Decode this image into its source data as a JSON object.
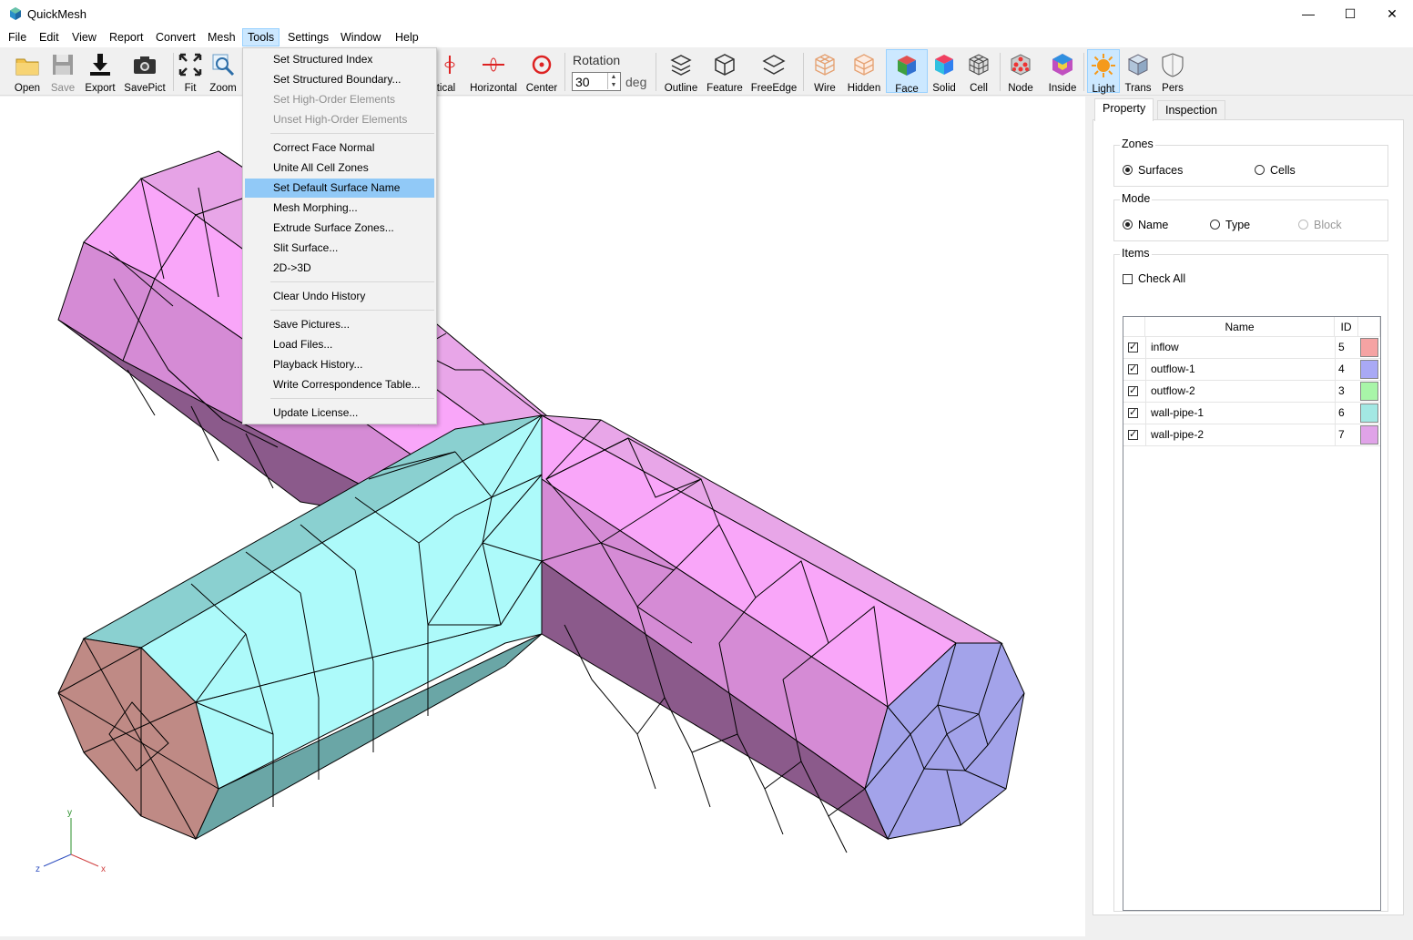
{
  "window": {
    "title": "QuickMesh",
    "min": "—",
    "max": "☐",
    "close": "✕"
  },
  "menubar": [
    "File",
    "Edit",
    "View",
    "Report",
    "Convert",
    "Mesh",
    "Tools",
    "Settings",
    "Window",
    "Help"
  ],
  "toolbar": {
    "open": "Open",
    "save": "Save",
    "export": "Export",
    "savepict": "SavePict",
    "fit": "Fit",
    "zoom": "Zoom",
    "vertical": "rtical",
    "horizontal": "Horizontal",
    "center": "Center",
    "rotation_label": "Rotation",
    "rotation_value": "30",
    "rotation_unit": "deg",
    "outline": "Outline",
    "feature": "Feature",
    "freeedge": "FreeEdge",
    "wire": "Wire",
    "hidden": "Hidden",
    "face": "Face",
    "solid": "Solid",
    "cell": "Cell",
    "node": "Node",
    "inside": "Inside",
    "light": "Light",
    "trans": "Trans",
    "pers": "Pers"
  },
  "tools_menu": {
    "items": [
      "Set Structured Index",
      "Set Structured Boundary...",
      "Set High-Order Elements",
      "Unset High-Order Elements",
      "Correct Face Normal",
      "Unite All Cell Zones",
      "Set Default Surface Name",
      "Mesh Morphing...",
      "Extrude Surface Zones...",
      "Slit Surface...",
      "2D->3D",
      "Clear Undo History",
      "Save Pictures...",
      "Load Files...",
      "Playback History...",
      "Write Correspondence Table...",
      "Update License..."
    ]
  },
  "panel": {
    "tabs": [
      "Property",
      "Inspection"
    ],
    "zones": {
      "title": "Zones",
      "surfaces": "Surfaces",
      "cells": "Cells"
    },
    "mode": {
      "title": "Mode",
      "name": "Name",
      "type": "Type",
      "block": "Block"
    },
    "items": {
      "title": "Items",
      "check_all": "Check All",
      "col_name": "Name",
      "col_id": "ID",
      "rows": [
        {
          "name": "inflow",
          "id": "5",
          "color": "#f5a3a3"
        },
        {
          "name": "outflow-1",
          "id": "4",
          "color": "#a9a9f5"
        },
        {
          "name": "outflow-2",
          "id": "3",
          "color": "#a8f5a8"
        },
        {
          "name": "wall-pipe-1",
          "id": "6",
          "color": "#a3e8e3"
        },
        {
          "name": "wall-pipe-2",
          "id": "7",
          "color": "#e0a3e8"
        }
      ]
    }
  },
  "axes": {
    "x": "x",
    "y": "y",
    "z": "z"
  }
}
